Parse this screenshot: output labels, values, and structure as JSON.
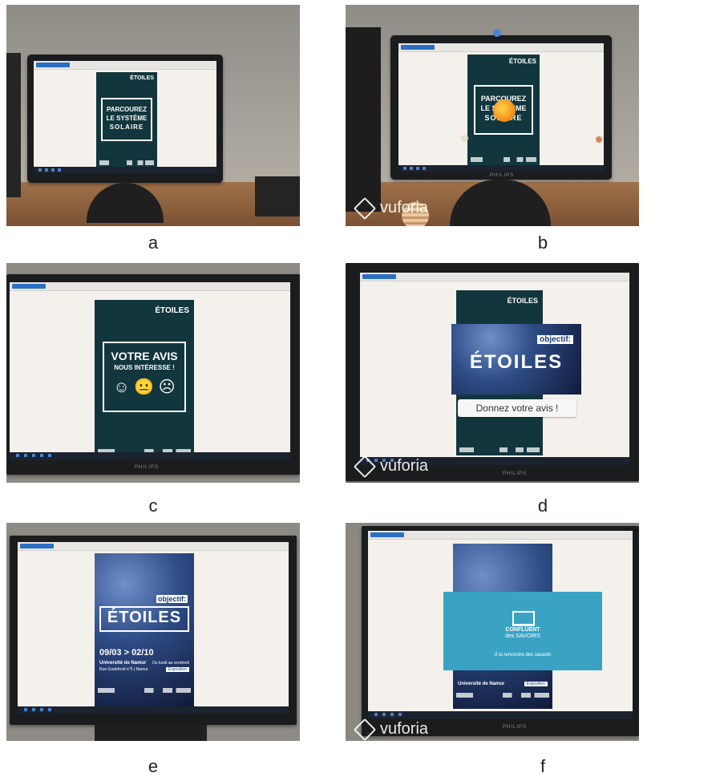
{
  "panels": [
    {
      "caption": "a",
      "monitor_brand": "",
      "poster": {
        "header": "ÉTOILES",
        "lines": [
          "PARCOUREZ",
          "LE SYSTÈME",
          "SOLAIRE"
        ]
      }
    },
    {
      "caption": "b",
      "monitor_brand": "PHILIPS",
      "watermark": "vuforia",
      "poster": {
        "header": "ÉTOILES",
        "lines": [
          "PARCOUREZ",
          "LE SYSTÈME",
          "SOLAIRE"
        ]
      }
    },
    {
      "caption": "c",
      "monitor_brand": "PHILIPS",
      "poster": {
        "header": "ÉTOILES",
        "lines": [
          "VOTRE AVIS",
          "NOUS INTÉRESSE !"
        ],
        "faces": [
          "☺",
          "😐",
          "☹"
        ]
      }
    },
    {
      "caption": "d",
      "monitor_brand": "PHILIPS",
      "watermark": "vuforia",
      "poster": {
        "header": "ÉTOILES"
      },
      "overlay": {
        "objectif": "objectif:",
        "title": "ÉTOILES",
        "button": "Donnez votre avis !"
      }
    },
    {
      "caption": "e",
      "monitor_brand": "",
      "poster": {
        "objectif": "objectif:",
        "title": "ÉTOILES",
        "dates": "09/03 > 02/10",
        "venue": "Université de Namur",
        "address": "Rue Godefroid n°5 | Namur",
        "schedule": "Du lundi au vendredi",
        "type": "Exposition"
      }
    },
    {
      "caption": "f",
      "monitor_brand": "PHILIPS",
      "watermark": "vuforia",
      "poster": {
        "venue": "Université de Namur",
        "type": "Exposition"
      },
      "overlay": {
        "org_line1": "CONFLUENT",
        "org_line2": "des SAVOIRS",
        "tagline": "À la rencontre des savants"
      }
    }
  ]
}
